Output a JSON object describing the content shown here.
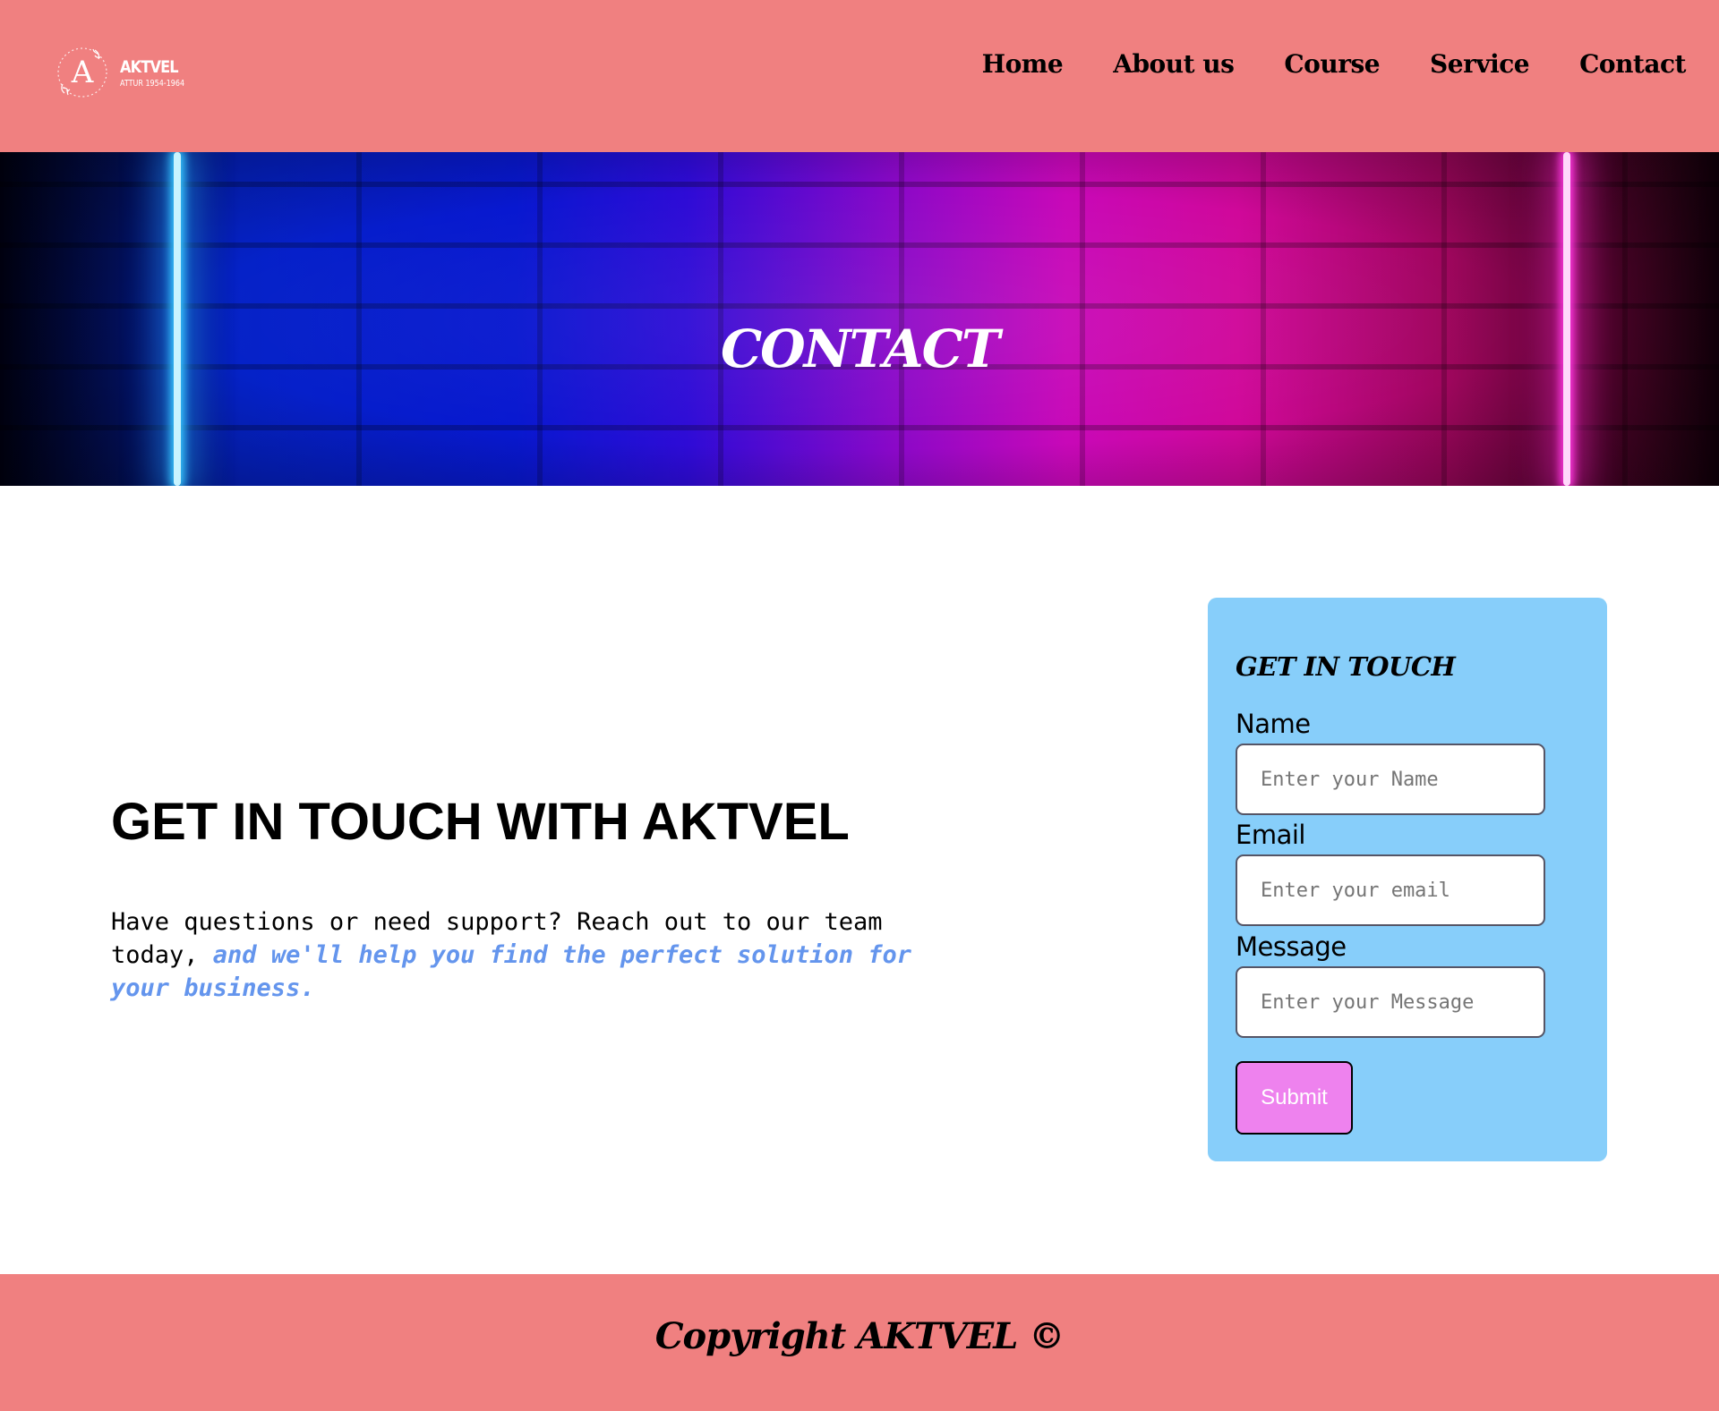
{
  "brand": {
    "name": "AKTVEL",
    "subtitle": "ATTUR 1954-1964",
    "emblem_letter": "A"
  },
  "nav": {
    "items": [
      {
        "label": "Home"
      },
      {
        "label": "About us"
      },
      {
        "label": "Course"
      },
      {
        "label": "Service"
      },
      {
        "label": "Contact"
      }
    ]
  },
  "banner": {
    "title": "CONTACT"
  },
  "intro": {
    "heading": "GET IN TOUCH WITH AKTVEL",
    "text_plain": "Have questions or need support? Reach out to our team today, ",
    "text_highlight": "and we'll help you find the perfect solution for your business."
  },
  "form": {
    "title": "GET IN TOUCH",
    "name_label": "Name",
    "name_placeholder": "Enter your Name",
    "name_value": "",
    "email_label": "Email",
    "email_placeholder": "Enter your email",
    "email_value": "",
    "message_label": "Message",
    "message_placeholder": "Enter your Message",
    "message_value": "",
    "submit_label": "Submit"
  },
  "footer": {
    "copyright": "Copyright AKTVEL ©"
  },
  "colors": {
    "header_bg": "#f08080",
    "footer_bg": "#f08080",
    "card_bg": "#87cefa",
    "submit_bg": "#ee82ee",
    "highlight_text": "#6495ed"
  }
}
